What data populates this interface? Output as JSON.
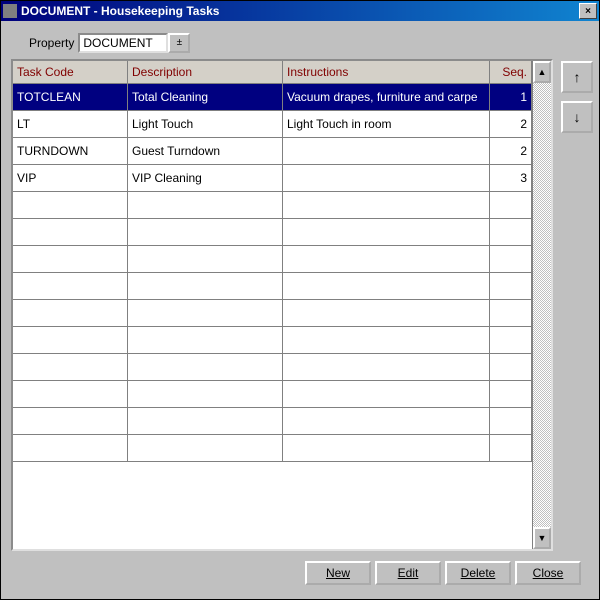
{
  "titlebar": {
    "title": "DOCUMENT - Housekeeping Tasks"
  },
  "property": {
    "label": "Property",
    "value": "DOCUMENT"
  },
  "columns": {
    "code": "Task Code",
    "desc": "Description",
    "instr": "Instructions",
    "seq": "Seq."
  },
  "rows": [
    {
      "code": "TOTCLEAN",
      "desc": "Total Cleaning",
      "instr": "Vacuum drapes, furniture and carpe",
      "seq": "1",
      "selected": true
    },
    {
      "code": "LT",
      "desc": "Light Touch",
      "instr": "Light Touch in room",
      "seq": "2",
      "selected": false
    },
    {
      "code": "TURNDOWN",
      "desc": "Guest Turndown",
      "instr": "",
      "seq": "2",
      "selected": false
    },
    {
      "code": "VIP",
      "desc": "VIP Cleaning",
      "instr": "",
      "seq": "3",
      "selected": false
    }
  ],
  "empty_row_count": 10,
  "side": {
    "up": "↑",
    "down": "↓"
  },
  "footer": {
    "new": "New",
    "edit": "Edit",
    "delete": "Delete",
    "close": "Close"
  },
  "icons": {
    "dropdown": "±",
    "close": "×",
    "scroll_up": "▲",
    "scroll_down": "▼"
  }
}
